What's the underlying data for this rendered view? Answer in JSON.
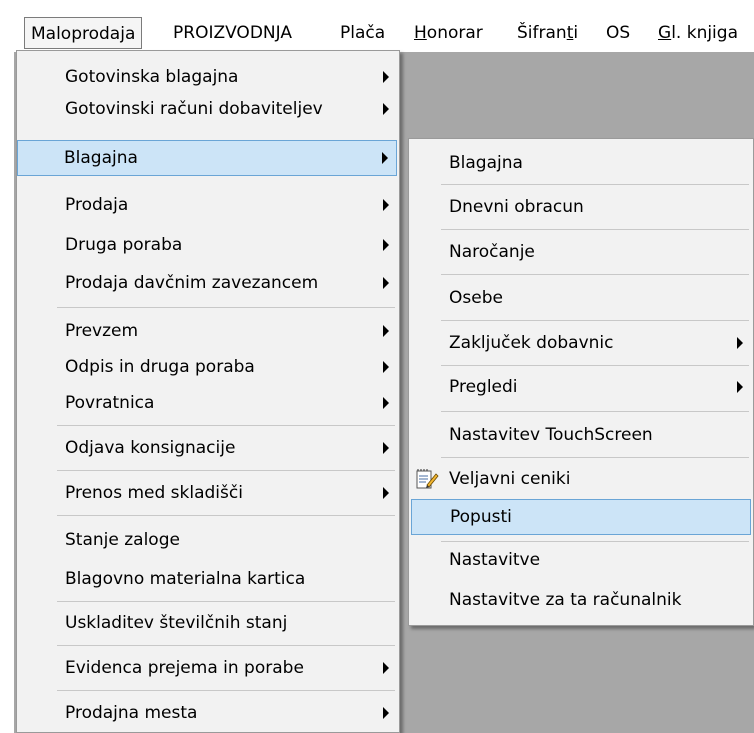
{
  "menubar": {
    "items": [
      {
        "label": "Maloprodaja"
      },
      {
        "label": "PROIZVODNJA"
      },
      {
        "label": "Plača"
      },
      {
        "label_pre": "",
        "label_u": "H",
        "label_post": "onorar"
      },
      {
        "label_pre": "Šifran",
        "label_u": "t",
        "label_post": "i"
      },
      {
        "label": "OS"
      },
      {
        "label_pre": "",
        "label_u": "G",
        "label_post": "l. knjiga"
      }
    ]
  },
  "main_menu": {
    "items": [
      {
        "label": "Gotovinska blagajna",
        "submenu": true
      },
      {
        "label": "Gotovinski računi dobaviteljev",
        "submenu": true
      },
      {
        "label": "Blagajna",
        "submenu": true,
        "highlighted": true
      },
      {
        "label": "Prodaja",
        "submenu": true
      },
      {
        "label": "Druga poraba",
        "submenu": true
      },
      {
        "label": "Prodaja davčnim zavezancem",
        "submenu": true
      },
      {
        "label": "Prevzem",
        "submenu": true
      },
      {
        "label": "Odpis in druga poraba",
        "submenu": true
      },
      {
        "label": "Povratnica",
        "submenu": true
      },
      {
        "label": "Odjava konsignacije",
        "submenu": true
      },
      {
        "label": "Prenos med skladišči",
        "submenu": true
      },
      {
        "label": "Stanje zaloge",
        "submenu": false
      },
      {
        "label": "Blagovno materialna kartica",
        "submenu": false
      },
      {
        "label": "Uskladitev številčnih stanj",
        "submenu": false
      },
      {
        "label": "Evidenca prejema in porabe",
        "submenu": true
      },
      {
        "label": "Prodajna mesta",
        "submenu": true
      }
    ]
  },
  "sub_menu": {
    "items": [
      {
        "label": "Blagajna"
      },
      {
        "label": "Dnevni obracun"
      },
      {
        "label": "Naročanje"
      },
      {
        "label": "Osebe"
      },
      {
        "label": "Zaključek dobavnic",
        "submenu": true
      },
      {
        "label": "Pregledi",
        "submenu": true
      },
      {
        "label": "Nastavitev TouchScreen"
      },
      {
        "label": "Veljavni ceniki",
        "icon": "notepad-pencil-icon"
      },
      {
        "label": "Popusti",
        "highlighted": true
      },
      {
        "label": "Nastavitve"
      },
      {
        "label": "Nastavitve za ta računalnik"
      }
    ]
  },
  "colors": {
    "highlight_bg": "#cce4f7",
    "highlight_border": "#6aa5d6",
    "menu_bg": "#f2f2f2",
    "desktop_bg": "#a7a7a7"
  }
}
